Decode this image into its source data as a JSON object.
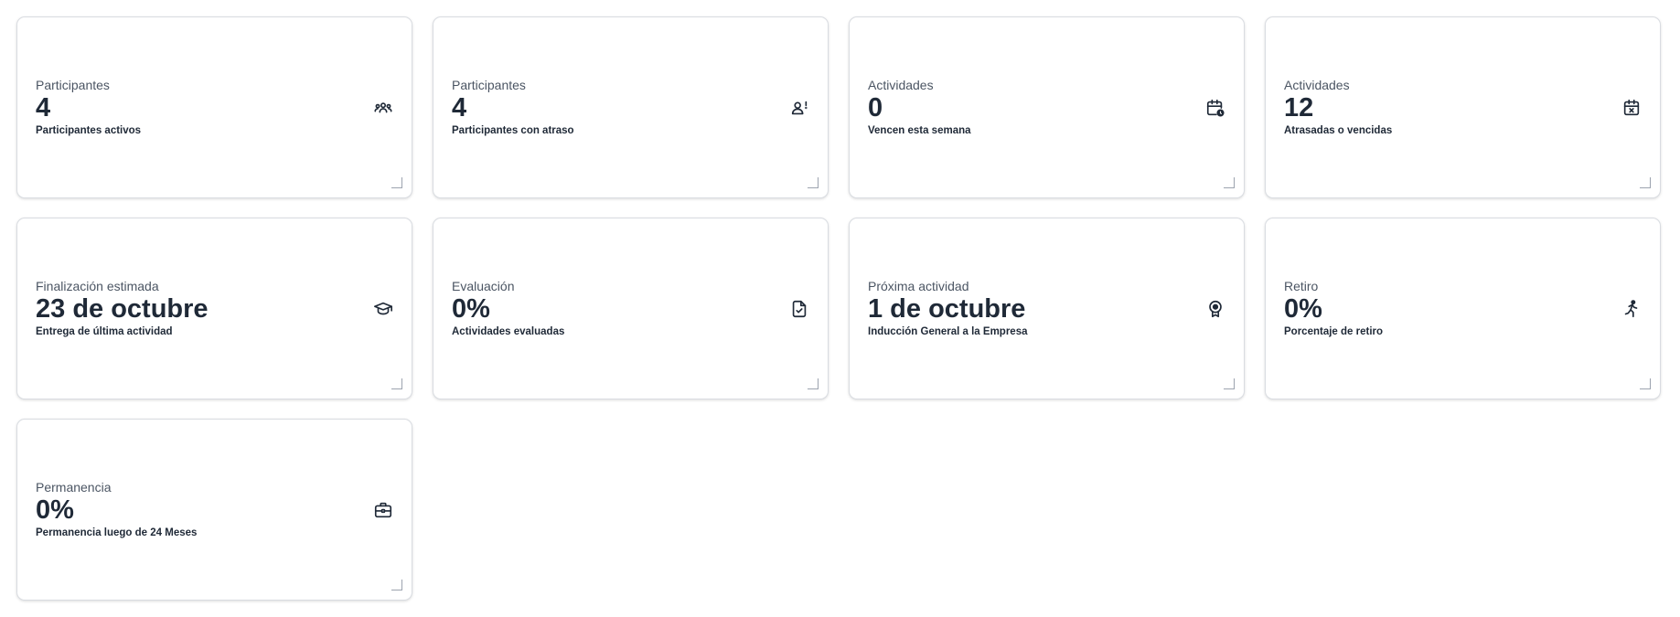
{
  "cards": [
    {
      "label": "Participantes",
      "value": "4",
      "description": "Participantes activos",
      "icon": "users-group-icon"
    },
    {
      "label": "Participantes",
      "value": "4",
      "description": "Participantes con atraso",
      "icon": "user-alert-icon"
    },
    {
      "label": "Actividades",
      "value": "0",
      "description": "Vencen esta semana",
      "icon": "calendar-clock-icon"
    },
    {
      "label": "Actividades",
      "value": "12",
      "description": "Atrasadas o vencidas",
      "icon": "calendar-x-icon"
    },
    {
      "label": "Finalización estimada",
      "value": "23 de octubre",
      "description": "Entrega de última actividad",
      "icon": "graduation-cap-icon"
    },
    {
      "label": "Evaluación",
      "value": "0%",
      "description": "Actividades evaluadas",
      "icon": "file-check-icon"
    },
    {
      "label": "Próxima actividad",
      "value": "1 de octubre",
      "description": "Inducción General a la Empresa",
      "icon": "award-icon"
    },
    {
      "label": "Retiro",
      "value": "0%",
      "description": "Porcentaje de retiro",
      "icon": "running-person-icon"
    },
    {
      "label": "Permanencia",
      "value": "0%",
      "description": "Permanencia luego de 24 Meses",
      "icon": "briefcase-icon"
    }
  ],
  "colors": {
    "text": "#1f2937",
    "muted": "#4b5563",
    "border": "#d9dce1"
  }
}
